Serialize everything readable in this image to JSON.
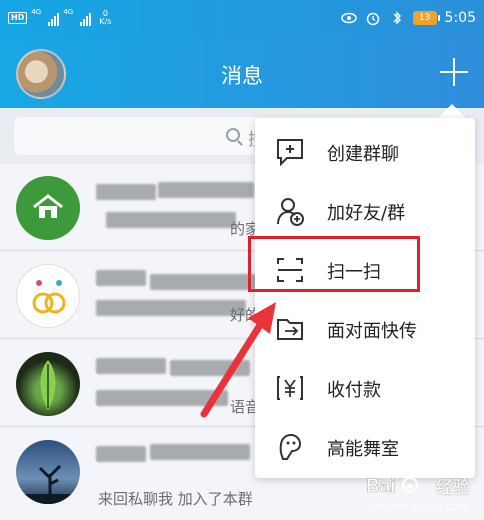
{
  "status_bar": {
    "hd": "HD",
    "signal1": "4G",
    "signal2": "4G",
    "speed_value": "0",
    "speed_unit": "K/s",
    "battery": "13",
    "time": "5:05"
  },
  "header": {
    "title": "消息"
  },
  "search": {
    "placeholder": "搜"
  },
  "chats": {
    "row1_title": "团",
    "row1_snippet": "的家",
    "row2_title": "购",
    "row2_snippet": "好的",
    "row3_title": "群",
    "row3_snippet": "语音",
    "row4_title": "人",
    "row4_snippet": "来回私聊我 加入了本群"
  },
  "menu": {
    "items": [
      {
        "label": "创建群聊",
        "icon": "chat-plus-icon"
      },
      {
        "label": "加好友/群",
        "icon": "add-user-icon"
      },
      {
        "label": "扫一扫",
        "icon": "scan-icon"
      },
      {
        "label": "面对面快传",
        "icon": "folder-transfer-icon"
      },
      {
        "label": "收付款",
        "icon": "yuan-icon"
      },
      {
        "label": "高能舞室",
        "icon": "ghost-icon"
      }
    ]
  },
  "watermark": {
    "text": "经验",
    "domain": "jingyan.baidu.com"
  },
  "colors": {
    "header": "#18a8e5",
    "highlight": "#e0202a",
    "arrow": "#e8333a"
  }
}
